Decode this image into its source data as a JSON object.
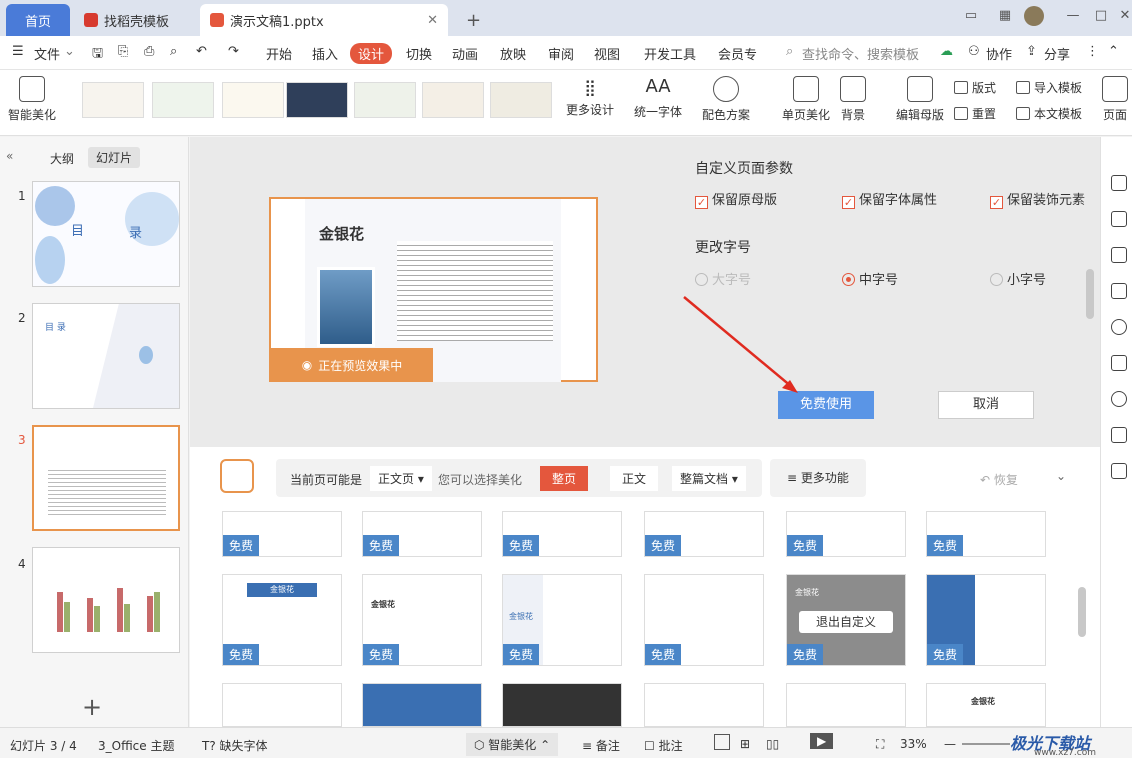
{
  "tabs": {
    "home": "首页",
    "daoke": "找稻壳模板",
    "doc": "演示文稿1.pptx",
    "add": "+"
  },
  "window": {
    "min": "—",
    "max": "□",
    "close": "✕"
  },
  "menu": {
    "file": "文件",
    "items": [
      "开始",
      "插入",
      "设计",
      "切换",
      "动画",
      "放映",
      "审阅",
      "视图",
      "开发工具",
      "会员专"
    ],
    "search": "查找命令、搜索模板",
    "collab": "协作",
    "share": "分享"
  },
  "ribbon": {
    "smart": "智能美化",
    "more_design": "更多设计",
    "unify_font": "统一字体",
    "color_scheme": "配色方案",
    "single_page": "单页美化",
    "background": "背景",
    "edit_master": "编辑母版",
    "layout": "版式",
    "reset": "重置",
    "import_tpl": "导入模板",
    "this_tpl": "本文模板",
    "page": "页面"
  },
  "leftpanel": {
    "outline": "大纲",
    "slides": "幻灯片",
    "nums": [
      "1",
      "2",
      "3",
      "4"
    ],
    "toc": "目",
    "toc2": "录",
    "toc_en": "目 录",
    "add": "+"
  },
  "preview": {
    "title": "金银花",
    "status": "正在预览效果中"
  },
  "settings": {
    "custom_title": "自定义页面参数",
    "opts": [
      "保留原母版",
      "保留字体属性",
      "保留装饰元素"
    ],
    "font_title": "更改字号",
    "sizes": [
      "大字号",
      "中字号",
      "小字号"
    ],
    "free_use": "免费使用",
    "cancel": "取消"
  },
  "toolbar": {
    "current": "当前页可能是",
    "body_page": "正文页",
    "can_choose": "您可以选择美化",
    "whole": "整页",
    "body": "正文",
    "full_doc": "整篇文档",
    "more": "更多功能",
    "restore": "恢复"
  },
  "grid": {
    "free": "免费",
    "title": "金银花",
    "exit_custom": "退出自定义"
  },
  "status": {
    "slide": "幻灯片 3 / 4",
    "theme": "3_Office 主题",
    "missing_font": "缺失字体",
    "smart": "智能美化",
    "notes": "备注",
    "comment": "批注",
    "zoom": "33%"
  },
  "watermark": {
    "name": "极光下载站",
    "url": "www.xz7.com"
  },
  "colors": {
    "accent": "#e4573d",
    "blue": "#4a86c8",
    "home_tab": "#4a7bd8",
    "orange": "#e8944c"
  }
}
